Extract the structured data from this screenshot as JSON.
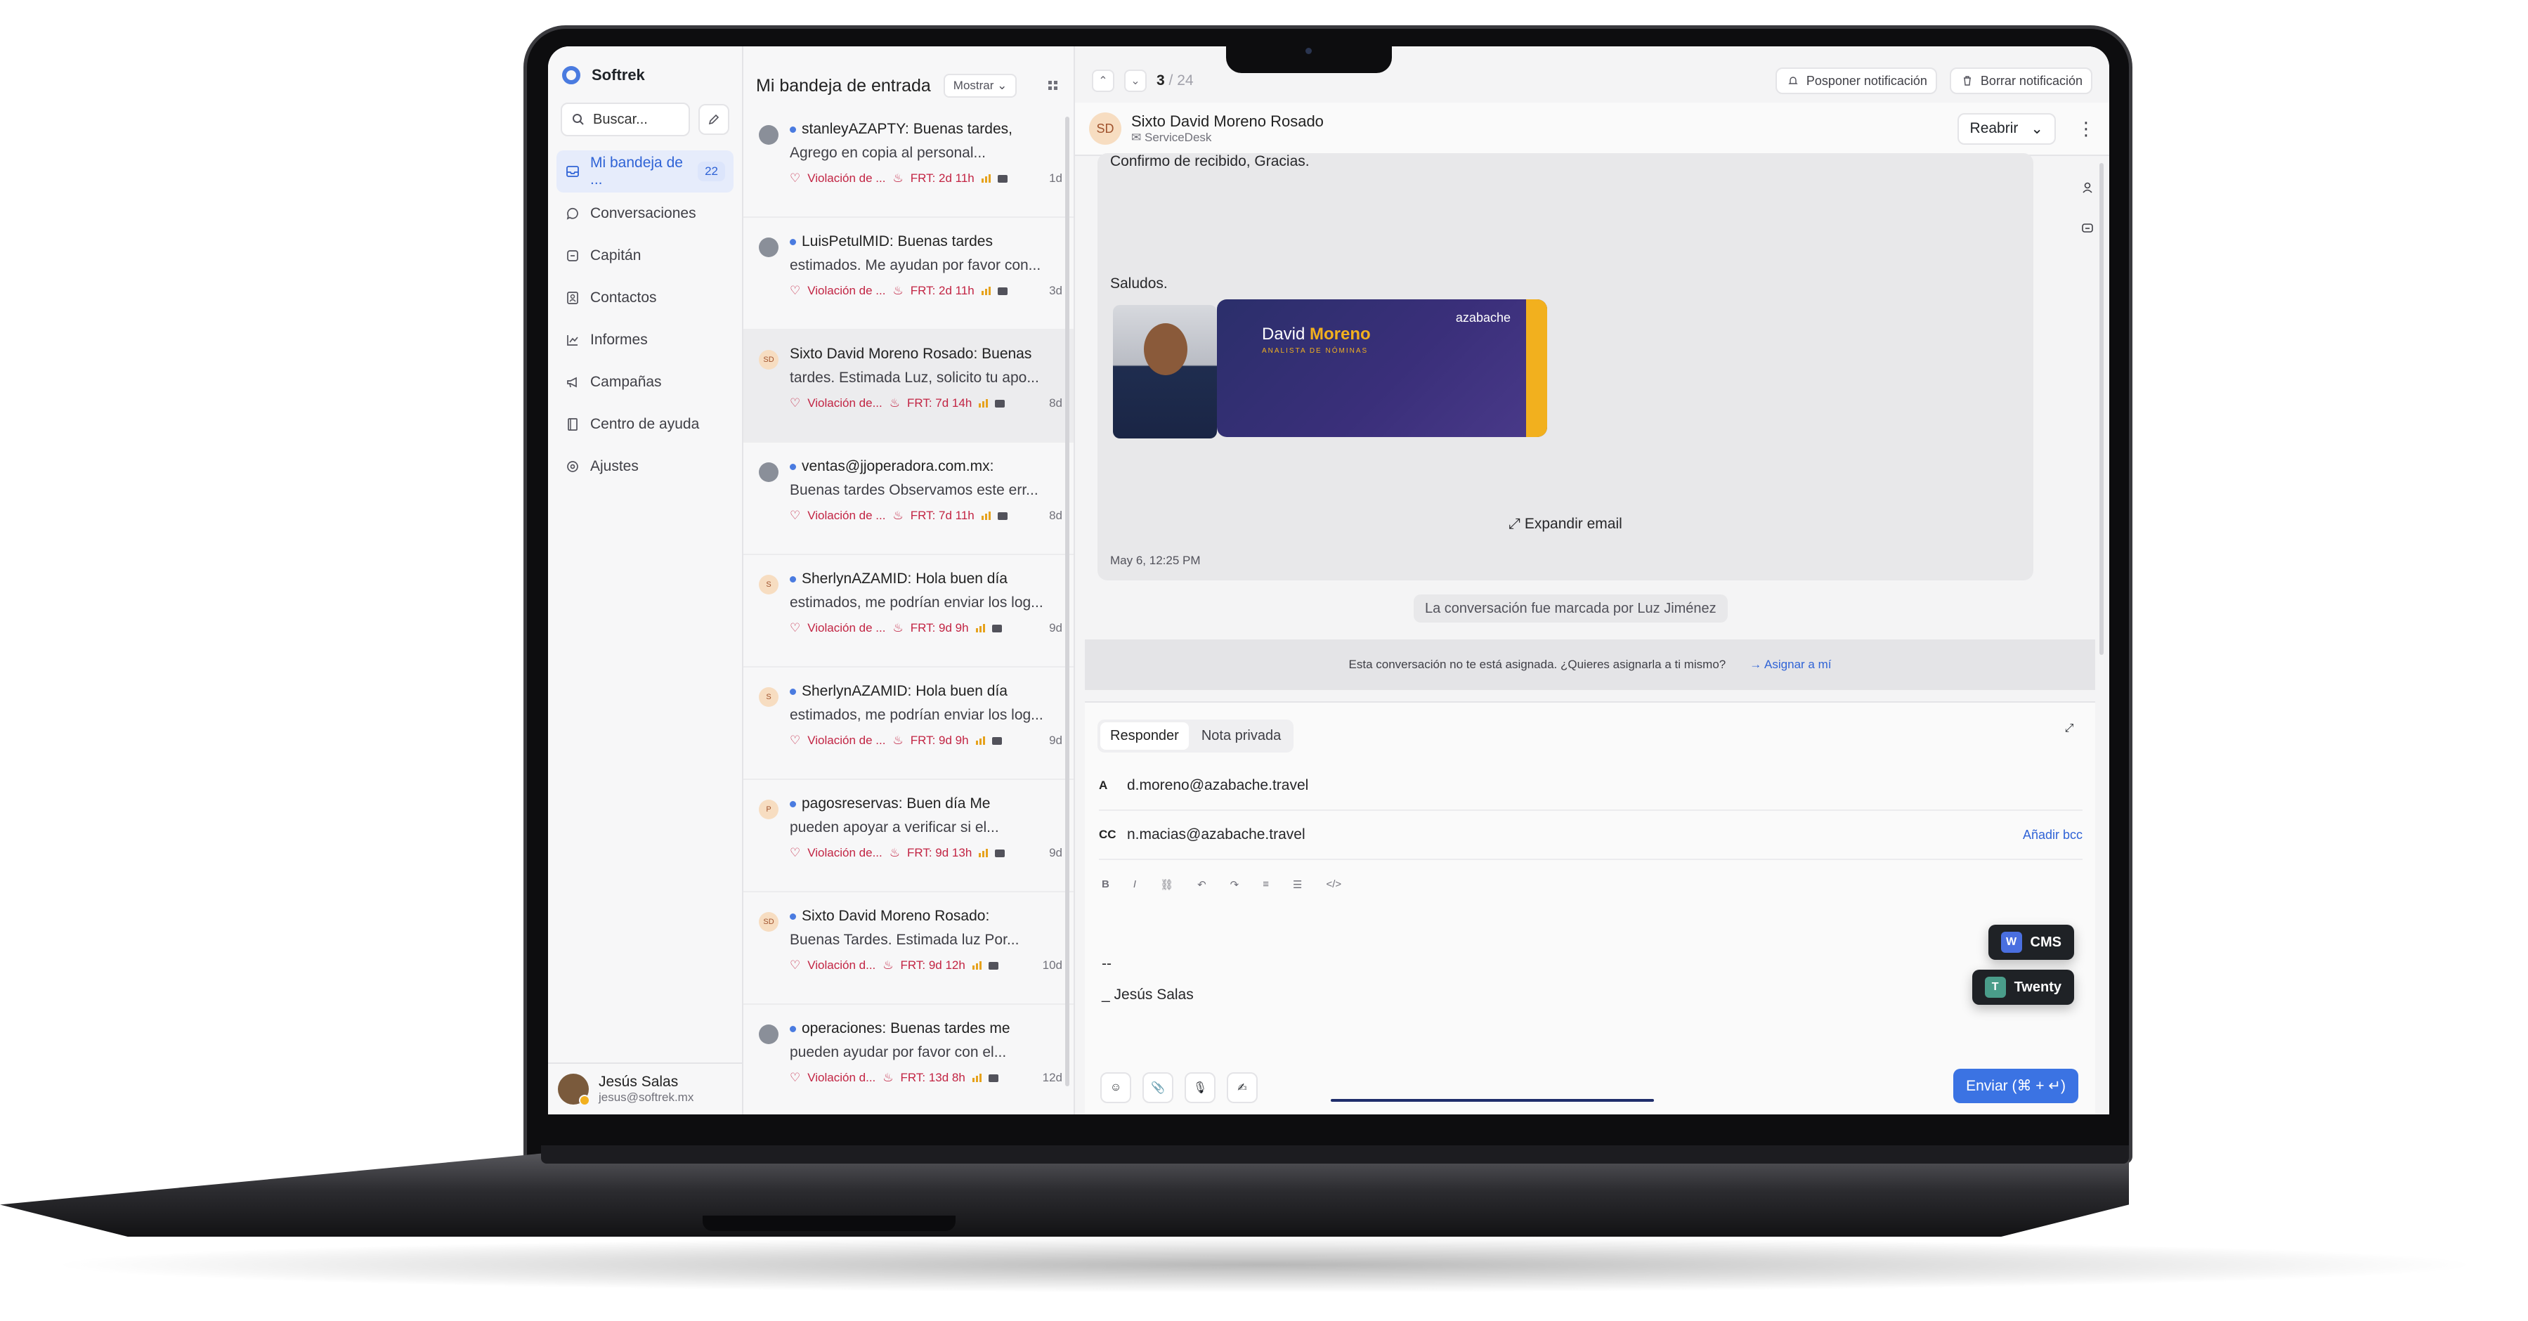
{
  "app": {
    "name": "Softrek"
  },
  "sidebar": {
    "search_placeholder": "Buscar...",
    "items": [
      {
        "label": "Mi bandeja de ...",
        "badge": "22",
        "icon": "inbox-icon",
        "active": true
      },
      {
        "label": "Conversaciones",
        "icon": "chat-icon"
      },
      {
        "label": "Capitán",
        "icon": "captain-icon"
      },
      {
        "label": "Contactos",
        "icon": "contacts-icon"
      },
      {
        "label": "Informes",
        "icon": "chart-icon"
      },
      {
        "label": "Campañas",
        "icon": "megaphone-icon"
      },
      {
        "label": "Centro de ayuda",
        "icon": "book-icon"
      },
      {
        "label": "Ajustes",
        "icon": "gear-icon"
      }
    ],
    "user": {
      "name": "Jesús Salas",
      "email": "jesus@softrek.mx"
    }
  },
  "list": {
    "title": "Mi bandeja de entrada",
    "show_label": "Mostrar",
    "conversations": [
      {
        "line1": "stanleyAZAPTY: Buenas tardes,",
        "line2": "Agrego en copia al personal...",
        "sla": "Violación de ...",
        "frt": "FRT: 2d 11h",
        "age": "1d"
      },
      {
        "line1": "LuisPetulMID: Buenas tardes",
        "line2": "estimados. Me ayudan por favor con...",
        "sla": "Violación de ...",
        "frt": "FRT: 2d 11h",
        "age": "3d"
      },
      {
        "avatar": "SD",
        "line1": "Sixto David Moreno Rosado: Buenas",
        "line2": "tardes. Estimada Luz, solicito tu apo...",
        "sla": "Violación de...",
        "frt": "FRT: 7d 14h",
        "age": "8d"
      },
      {
        "line1": "ventas@jjoperadora.com.mx:",
        "line2": "Buenas tardes Observamos este err...",
        "sla": "Violación de ...",
        "frt": "FRT: 7d 11h",
        "age": "8d"
      },
      {
        "avatar": "S",
        "line1": "SherlynAZAMID: Hola buen día",
        "line2": "estimados, me podrían enviar los log...",
        "sla": "Violación de ...",
        "frt": "FRT: 9d 9h",
        "age": "9d"
      },
      {
        "avatar": "S",
        "line1": "SherlynAZAMID: Hola buen día",
        "line2": "estimados, me podrían enviar los log...",
        "sla": "Violación de ...",
        "frt": "FRT: 9d 9h",
        "age": "9d"
      },
      {
        "avatar": "P",
        "line1": "pagosreservas: Buen día Me",
        "line2": "pueden apoyar a verificar si el...",
        "sla": "Violación de...",
        "frt": "FRT: 9d 13h",
        "age": "9d"
      },
      {
        "avatar": "SD",
        "line1": "Sixto David Moreno Rosado:",
        "line2": "Buenas Tardes. Estimada luz Por...",
        "sla": "Violación d...",
        "frt": "FRT: 9d 12h",
        "age": "10d"
      },
      {
        "line1": "operaciones: Buenas tardes me",
        "line2": "pueden ayudar por favor con el...",
        "sla": "Violación d...",
        "frt": "FRT: 13d 8h",
        "age": "12d"
      }
    ]
  },
  "main": {
    "counter_current": "3",
    "counter_total": "/ 24",
    "snooze_label": "Posponer notificación",
    "delete_label": "Borrar notificación",
    "sender": {
      "initials": "SD",
      "name": "Sixto David Moreno Rosado",
      "inbox": "ServiceDesk"
    },
    "reopen_label": "Reabrir",
    "email": {
      "confirm_text": "Confirmo de recibido, Gracias.",
      "greeting": "Saludos.",
      "card_name_first": "David",
      "card_name_last": "Moreno",
      "card_role": "ANALISTA DE NÓMINAS",
      "card_brand": "azabache",
      "expand_label": "Expandir email",
      "date": "May 6, 12:25 PM"
    },
    "marked_text": "La conversación fue marcada por Luz Jiménez",
    "assign_notice": "Esta conversación no te está asignada. ¿Quieres asignarla a ti mismo?",
    "assign_link": "Asignar a mí",
    "reply": {
      "tab_reply": "Responder",
      "tab_private": "Nota privada",
      "to_label": "A",
      "to_value": "d.moreno@azabache.travel",
      "cc_label": "CC",
      "cc_value": "n.macias@azabache.travel",
      "add_bcc": "Añadir bcc",
      "sig_dash": "--",
      "sig_name": "_ Jesús Salas",
      "send_label": "Enviar (⌘ + ↵)"
    },
    "floaters": [
      {
        "letter": "W",
        "label": "CMS",
        "color": "#4a6fe0"
      },
      {
        "letter": "T",
        "label": "Twenty",
        "color": "#4a9d8a"
      }
    ]
  }
}
